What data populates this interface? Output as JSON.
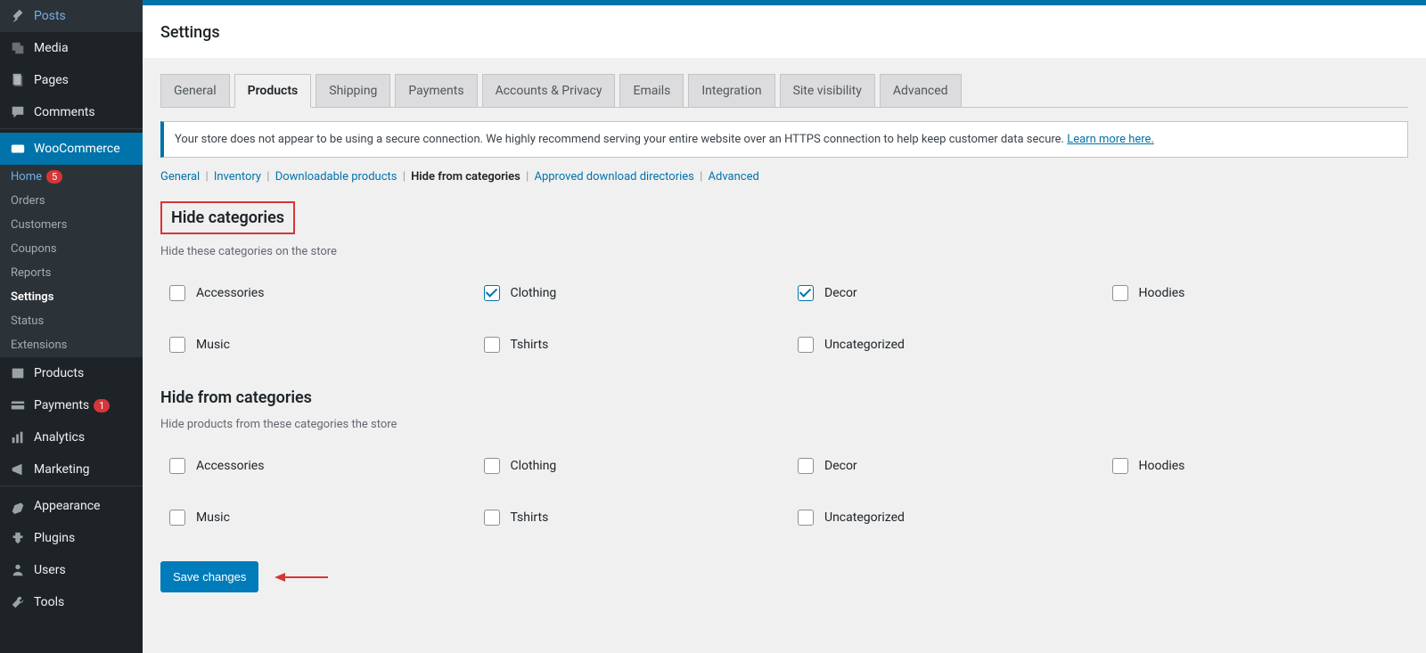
{
  "sidebar": {
    "items": [
      {
        "label": "Posts",
        "icon": "pin"
      },
      {
        "label": "Media",
        "icon": "media"
      },
      {
        "label": "Pages",
        "icon": "pages"
      },
      {
        "label": "Comments",
        "icon": "comment"
      },
      {
        "label": "WooCommerce",
        "icon": "woo",
        "active": true
      }
    ],
    "woo_sub": [
      {
        "label": "Home",
        "badge": "5",
        "highlight": true
      },
      {
        "label": "Orders"
      },
      {
        "label": "Customers"
      },
      {
        "label": "Coupons"
      },
      {
        "label": "Reports"
      },
      {
        "label": "Settings",
        "current": true
      },
      {
        "label": "Status"
      },
      {
        "label": "Extensions"
      }
    ],
    "items2": [
      {
        "label": "Products",
        "icon": "products"
      },
      {
        "label": "Payments",
        "icon": "payments",
        "badge": "1"
      },
      {
        "label": "Analytics",
        "icon": "analytics"
      },
      {
        "label": "Marketing",
        "icon": "marketing"
      }
    ],
    "items3": [
      {
        "label": "Appearance",
        "icon": "appearance"
      },
      {
        "label": "Plugins",
        "icon": "plugins"
      },
      {
        "label": "Users",
        "icon": "users"
      },
      {
        "label": "Tools",
        "icon": "tools"
      }
    ]
  },
  "header": {
    "title": "Settings"
  },
  "tabs": [
    "General",
    "Products",
    "Shipping",
    "Payments",
    "Accounts & Privacy",
    "Emails",
    "Integration",
    "Site visibility",
    "Advanced"
  ],
  "tabs_active_index": 1,
  "notice": {
    "text": "Your store does not appear to be using a secure connection. We highly recommend serving your entire website over an HTTPS connection to help keep customer data secure. ",
    "link": "Learn more here."
  },
  "subtabs": [
    "General",
    "Inventory",
    "Downloadable products",
    "Hide from categories",
    "Approved download directories",
    "Advanced"
  ],
  "subtabs_active_index": 3,
  "section1": {
    "title": "Hide categories",
    "desc": "Hide these categories on the store",
    "items": [
      {
        "label": "Accessories",
        "checked": false
      },
      {
        "label": "Clothing",
        "checked": true
      },
      {
        "label": "Decor",
        "checked": true
      },
      {
        "label": "Hoodies",
        "checked": false
      },
      {
        "label": "Music",
        "checked": false
      },
      {
        "label": "Tshirts",
        "checked": false
      },
      {
        "label": "Uncategorized",
        "checked": false
      }
    ]
  },
  "section2": {
    "title": "Hide from categories",
    "desc": "Hide products from these categories the store",
    "items": [
      {
        "label": "Accessories",
        "checked": false
      },
      {
        "label": "Clothing",
        "checked": false
      },
      {
        "label": "Decor",
        "checked": false
      },
      {
        "label": "Hoodies",
        "checked": false
      },
      {
        "label": "Music",
        "checked": false
      },
      {
        "label": "Tshirts",
        "checked": false
      },
      {
        "label": "Uncategorized",
        "checked": false
      }
    ]
  },
  "save_label": "Save changes"
}
